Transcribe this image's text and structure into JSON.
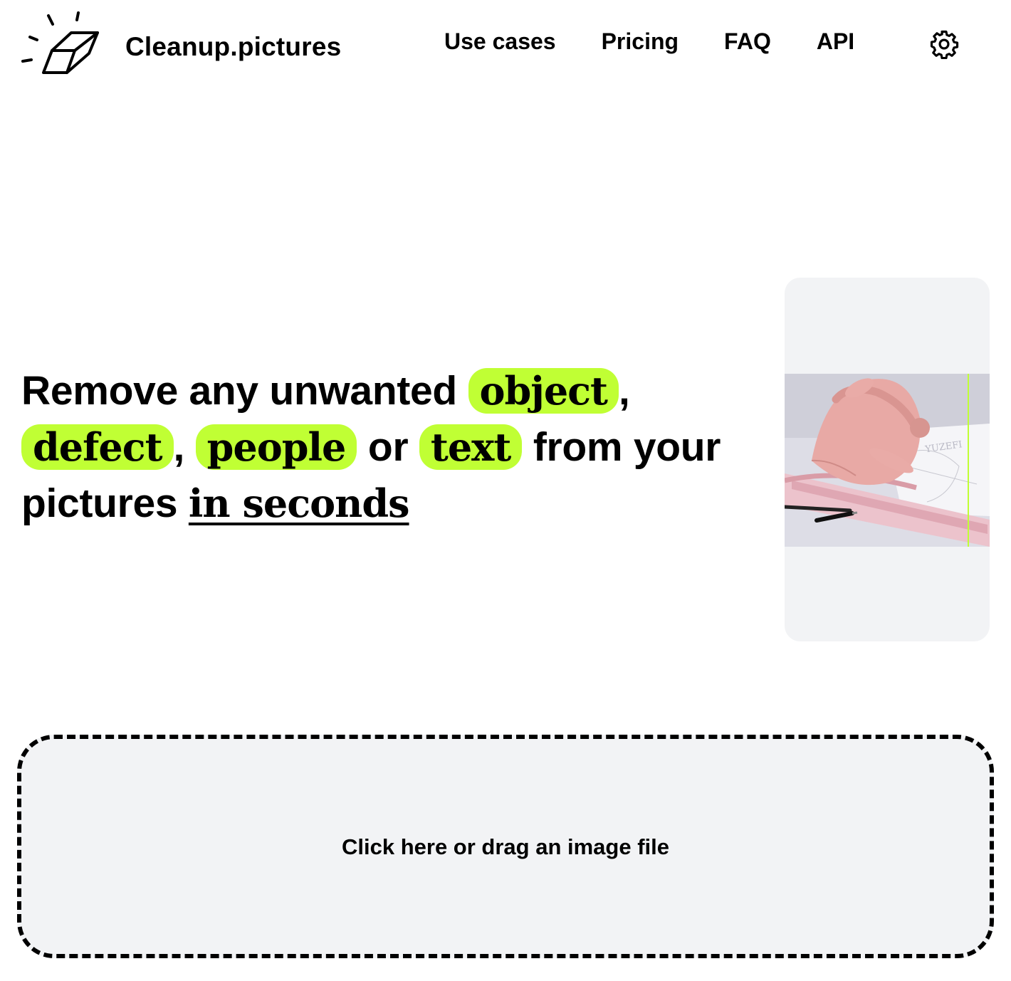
{
  "header": {
    "brand": "Cleanup.pictures",
    "logo_icon": "eraser-icon",
    "nav": [
      {
        "label": "Use cases"
      },
      {
        "label": "Pricing"
      },
      {
        "label": "FAQ"
      },
      {
        "label": "API"
      }
    ],
    "settings_icon": "gear-icon"
  },
  "hero": {
    "t1": "Remove any unwanted ",
    "hl1": "object",
    "c1": ",",
    "hl2": "defect",
    "c2": ",",
    "hl3": "people",
    "t2": " or ",
    "hl4": "text",
    "t3": " from your pictures ",
    "emphasis": "in seconds"
  },
  "demo": {
    "brand_text": "YUZEFI",
    "divider_color": "#c0ff34"
  },
  "dropzone": {
    "label": "Click here or drag an image file"
  },
  "colors": {
    "accent": "#c0ff34",
    "panel": "#f2f3f5",
    "text": "#000000"
  }
}
